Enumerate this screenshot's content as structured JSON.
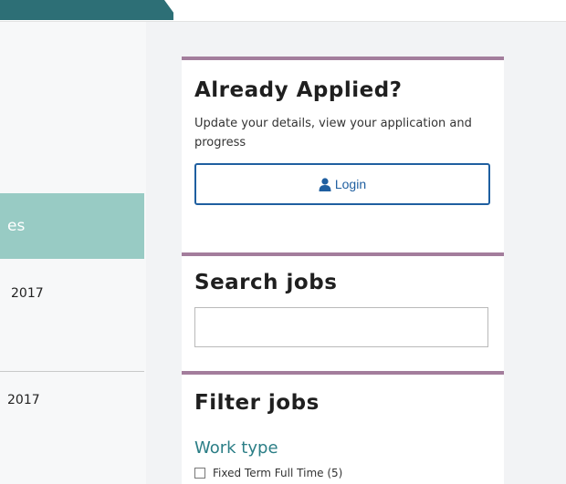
{
  "left": {
    "banner_text": "es",
    "dates": [
      "2017",
      "2017"
    ]
  },
  "applied": {
    "title": "Already Applied?",
    "description": "Update your details, view your application and progress",
    "login_label": "Login"
  },
  "search": {
    "title": "Search jobs",
    "input_value": "",
    "placeholder": ""
  },
  "filter": {
    "title": "Filter jobs",
    "section_heading": "Work type",
    "options": [
      {
        "label": "Fixed Term Full Time (5)"
      }
    ]
  },
  "colors": {
    "top_tab": "#2d6f76",
    "panel_border": "#a37d9c",
    "left_banner": "#98cbc4",
    "login_blue": "#1f5fa0",
    "filter_heading": "#2b7e86"
  }
}
